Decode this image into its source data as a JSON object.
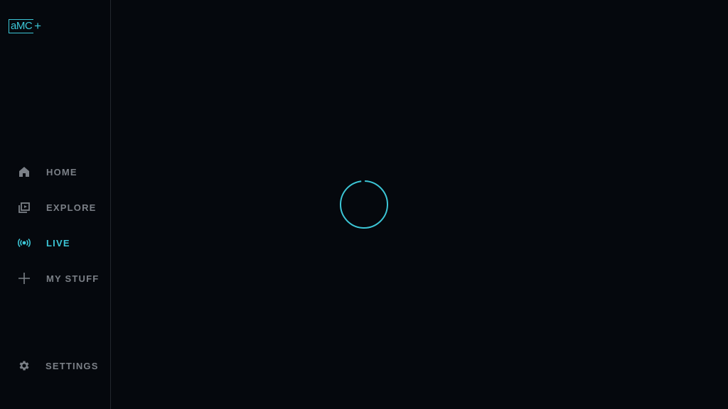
{
  "app": {
    "logo_text": "aMC",
    "logo_plus": "+",
    "accent_color": "#3cc6d6",
    "background_color": "#05080d"
  },
  "sidebar": {
    "items": [
      {
        "label": "HOME",
        "icon": "home-icon",
        "active": false
      },
      {
        "label": "EXPLORE",
        "icon": "explore-icon",
        "active": false
      },
      {
        "label": "LIVE",
        "icon": "live-broadcast-icon",
        "active": true
      },
      {
        "label": "MY STUFF",
        "icon": "plus-icon",
        "active": false
      }
    ],
    "settings": {
      "label": "SETTINGS",
      "icon": "gear-icon"
    }
  },
  "main": {
    "state": "loading",
    "spinner_icon": "loading-spinner-icon"
  }
}
